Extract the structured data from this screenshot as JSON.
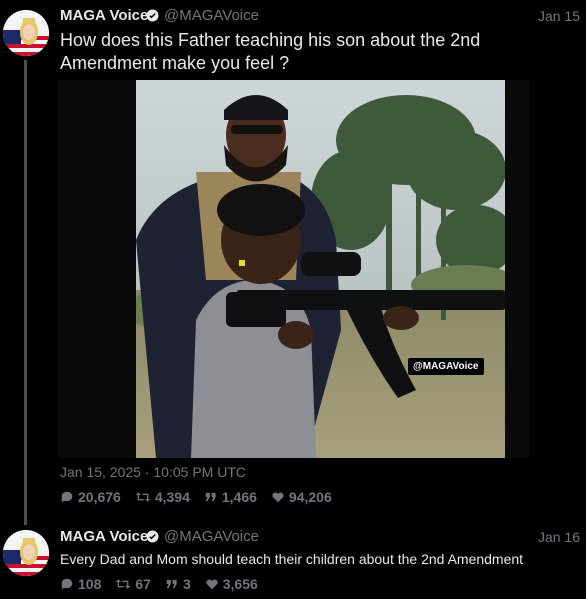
{
  "tweet1": {
    "author_name": "MAGA Voice",
    "handle": "@MAGAVoice",
    "date": "Jan 15",
    "text": "How does this Father teaching his son about the 2nd Amendment make you feel ?",
    "media_watermark": "@MAGAVoice",
    "timestamp": "Jan 15, 2025 · 10:05 PM UTC",
    "stats": {
      "replies": "20,676",
      "retweets": "4,394",
      "quotes": "1,466",
      "likes": "94,206"
    }
  },
  "tweet2": {
    "author_name": "MAGA Voice",
    "handle": "@MAGAVoice",
    "date": "Jan 16",
    "text": "Every Dad and Mom should teach their children about the 2nd Amendment",
    "stats": {
      "replies": "108",
      "retweets": "67",
      "quotes": "3",
      "likes": "3,656"
    }
  },
  "icons": [
    "verified-badge-icon",
    "reply-icon",
    "retweet-icon",
    "quote-icon",
    "like-icon"
  ],
  "colors": {
    "background": "#000000",
    "text": "#e7e9ea",
    "muted": "#71767b",
    "verified": "#e7e9ea"
  }
}
